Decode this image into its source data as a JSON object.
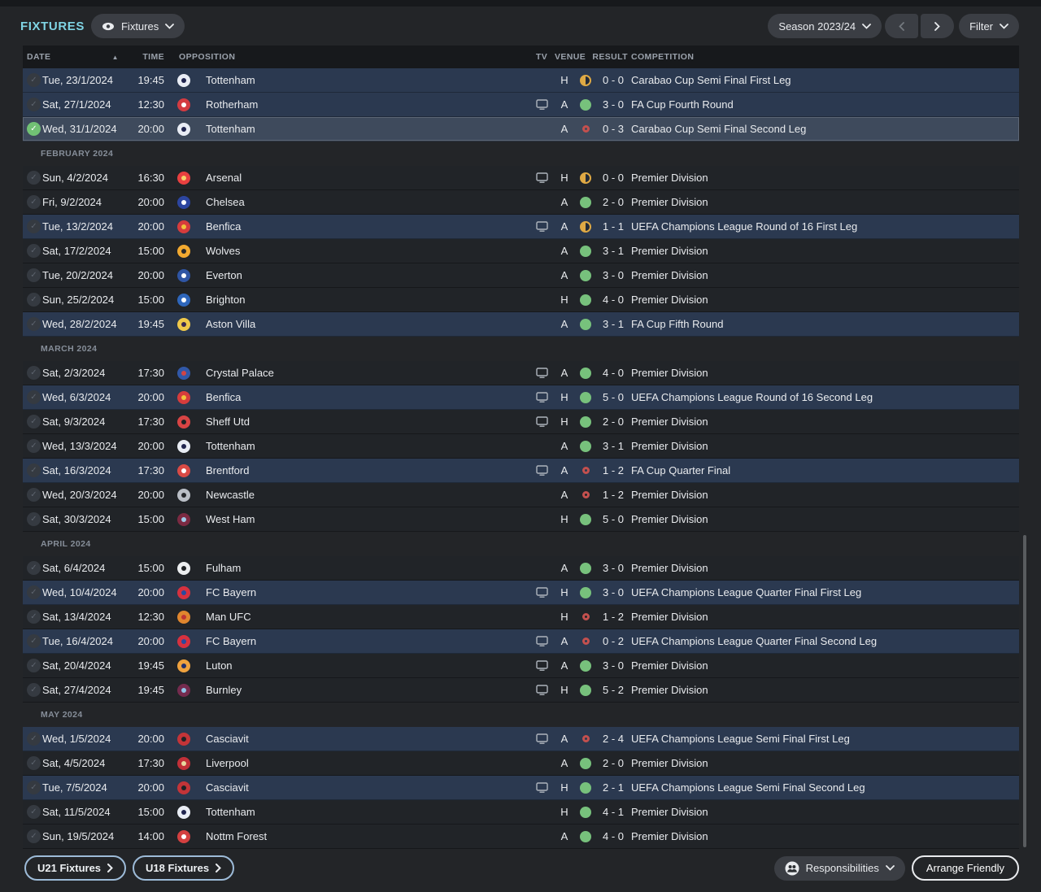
{
  "header": {
    "title": "FIXTURES",
    "view_dropdown_label": "Fixtures",
    "season_dropdown_label": "Season 2023/24",
    "filter_dropdown_label": "Filter"
  },
  "table": {
    "columns": {
      "date": "DATE",
      "time": "TIME",
      "opposition": "OPPOSITION",
      "tv": "TV",
      "venue": "VENUE",
      "result": "RESULT",
      "competition": "COMPETITION"
    },
    "sort": {
      "column": "DATE",
      "direction": "asc"
    },
    "sections": [
      {
        "month": "",
        "fixtures": [
          {
            "date": "Tue, 23/1/2024",
            "time": "19:45",
            "opposition": "Tottenham",
            "badge": [
              "#e9edf5",
              "#20254f"
            ],
            "tv": false,
            "venue": "H",
            "outcome": "draw",
            "score": "0 - 0",
            "competition": "Carabao Cup Semi Final First Leg",
            "cup": true,
            "selected": false
          },
          {
            "date": "Sat, 27/1/2024",
            "time": "12:30",
            "opposition": "Rotherham",
            "badge": [
              "#d43b41",
              "#ffffff"
            ],
            "tv": true,
            "venue": "A",
            "outcome": "win",
            "score": "3 - 0",
            "competition": "FA Cup Fourth Round",
            "cup": true,
            "selected": false
          },
          {
            "date": "Wed, 31/1/2024",
            "time": "20:00",
            "opposition": "Tottenham",
            "badge": [
              "#e9edf5",
              "#20254f"
            ],
            "tv": false,
            "venue": "A",
            "outcome": "loss",
            "score": "0 - 3",
            "competition": "Carabao Cup Semi Final Second Leg",
            "cup": true,
            "selected": true
          }
        ]
      },
      {
        "month": "FEBRUARY 2024",
        "fixtures": [
          {
            "date": "Sun, 4/2/2024",
            "time": "16:30",
            "opposition": "Arsenal",
            "badge": [
              "#e84040",
              "#f5d16a"
            ],
            "tv": true,
            "venue": "H",
            "outcome": "draw",
            "score": "0 - 0",
            "competition": "Premier Division",
            "cup": false,
            "selected": false
          },
          {
            "date": "Fri, 9/2/2024",
            "time": "20:00",
            "opposition": "Chelsea",
            "badge": [
              "#2c45a0",
              "#ffffff"
            ],
            "tv": false,
            "venue": "A",
            "outcome": "win",
            "score": "2 - 0",
            "competition": "Premier Division",
            "cup": false,
            "selected": false
          },
          {
            "date": "Tue, 13/2/2024",
            "time": "20:00",
            "opposition": "Benfica",
            "badge": [
              "#d63c3c",
              "#f0c23c"
            ],
            "tv": true,
            "venue": "A",
            "outcome": "draw",
            "score": "1 - 1",
            "competition": "UEFA Champions League Round of 16  First Leg",
            "cup": true,
            "selected": false
          },
          {
            "date": "Sat, 17/2/2024",
            "time": "15:00",
            "opposition": "Wolves",
            "badge": [
              "#f2a930",
              "#2a2a2a"
            ],
            "tv": false,
            "venue": "A",
            "outcome": "win",
            "score": "3 - 1",
            "competition": "Premier Division",
            "cup": false,
            "selected": false
          },
          {
            "date": "Tue, 20/2/2024",
            "time": "20:00",
            "opposition": "Everton",
            "badge": [
              "#2f55a4",
              "#ffffff"
            ],
            "tv": false,
            "venue": "A",
            "outcome": "win",
            "score": "3 - 0",
            "competition": "Premier Division",
            "cup": false,
            "selected": false
          },
          {
            "date": "Sun, 25/2/2024",
            "time": "15:00",
            "opposition": "Brighton",
            "badge": [
              "#2e66bb",
              "#ffffff"
            ],
            "tv": false,
            "venue": "H",
            "outcome": "win",
            "score": "4 - 0",
            "competition": "Premier Division",
            "cup": false,
            "selected": false
          },
          {
            "date": "Wed, 28/2/2024",
            "time": "19:45",
            "opposition": "Aston Villa",
            "badge": [
              "#f0c94a",
              "#3b2a52"
            ],
            "tv": false,
            "venue": "A",
            "outcome": "win",
            "score": "3 - 1",
            "competition": "FA Cup Fifth Round",
            "cup": true,
            "selected": false
          }
        ]
      },
      {
        "month": "MARCH 2024",
        "fixtures": [
          {
            "date": "Sat, 2/3/2024",
            "time": "17:30",
            "opposition": "Crystal Palace",
            "badge": [
              "#3158a8",
              "#d04545"
            ],
            "tv": true,
            "venue": "A",
            "outcome": "win",
            "score": "4 - 0",
            "competition": "Premier Division",
            "cup": false,
            "selected": false
          },
          {
            "date": "Wed, 6/3/2024",
            "time": "20:00",
            "opposition": "Benfica",
            "badge": [
              "#d63c3c",
              "#f0c23c"
            ],
            "tv": true,
            "venue": "H",
            "outcome": "win",
            "score": "5 - 0",
            "competition": "UEFA Champions League Round of 16  Second Leg",
            "cup": true,
            "selected": false
          },
          {
            "date": "Sat, 9/3/2024",
            "time": "17:30",
            "opposition": "Sheff Utd",
            "badge": [
              "#d84444",
              "#1f2225"
            ],
            "tv": true,
            "venue": "H",
            "outcome": "win",
            "score": "2 - 0",
            "competition": "Premier Division",
            "cup": false,
            "selected": false
          },
          {
            "date": "Wed, 13/3/2024",
            "time": "20:00",
            "opposition": "Tottenham",
            "badge": [
              "#e9edf5",
              "#20254f"
            ],
            "tv": false,
            "venue": "A",
            "outcome": "win",
            "score": "3 - 1",
            "competition": "Premier Division",
            "cup": false,
            "selected": false
          },
          {
            "date": "Sat, 16/3/2024",
            "time": "17:30",
            "opposition": "Brentford",
            "badge": [
              "#d94a45",
              "#ffffff"
            ],
            "tv": true,
            "venue": "A",
            "outcome": "loss",
            "score": "1 - 2",
            "competition": "FA Cup Quarter Final",
            "cup": true,
            "selected": false
          },
          {
            "date": "Wed, 20/3/2024",
            "time": "20:00",
            "opposition": "Newcastle",
            "badge": [
              "#b9bec6",
              "#23262a"
            ],
            "tv": false,
            "venue": "A",
            "outcome": "loss",
            "score": "1 - 2",
            "competition": "Premier Division",
            "cup": false,
            "selected": false
          },
          {
            "date": "Sat, 30/3/2024",
            "time": "15:00",
            "opposition": "West Ham",
            "badge": [
              "#7b2a42",
              "#9ecbe8"
            ],
            "tv": false,
            "venue": "H",
            "outcome": "win",
            "score": "5 - 0",
            "competition": "Premier Division",
            "cup": false,
            "selected": false
          }
        ]
      },
      {
        "month": "APRIL 2024",
        "fixtures": [
          {
            "date": "Sat, 6/4/2024",
            "time": "15:00",
            "opposition": "Fulham",
            "badge": [
              "#eceef0",
              "#1f2225"
            ],
            "tv": false,
            "venue": "A",
            "outcome": "win",
            "score": "3 - 0",
            "competition": "Premier Division",
            "cup": false,
            "selected": false
          },
          {
            "date": "Wed, 10/4/2024",
            "time": "20:00",
            "opposition": "FC Bayern",
            "badge": [
              "#d6313f",
              "#2a4a9e"
            ],
            "tv": true,
            "venue": "H",
            "outcome": "win",
            "score": "3 - 0",
            "competition": "UEFA Champions League Quarter Final First Leg",
            "cup": true,
            "selected": false
          },
          {
            "date": "Sat, 13/4/2024",
            "time": "12:30",
            "opposition": "Man UFC",
            "badge": [
              "#e0862e",
              "#c03535"
            ],
            "tv": false,
            "venue": "H",
            "outcome": "loss",
            "score": "1 - 2",
            "competition": "Premier Division",
            "cup": false,
            "selected": false
          },
          {
            "date": "Tue, 16/4/2024",
            "time": "20:00",
            "opposition": "FC Bayern",
            "badge": [
              "#d6313f",
              "#2a4a9e"
            ],
            "tv": true,
            "venue": "A",
            "outcome": "loss",
            "score": "0 - 2",
            "competition": "UEFA Champions League Quarter Final Second Leg",
            "cup": true,
            "selected": false
          },
          {
            "date": "Sat, 20/4/2024",
            "time": "19:45",
            "opposition": "Luton",
            "badge": [
              "#efa23e",
              "#22306e"
            ],
            "tv": true,
            "venue": "A",
            "outcome": "win",
            "score": "3 - 0",
            "competition": "Premier Division",
            "cup": false,
            "selected": false
          },
          {
            "date": "Sat, 27/4/2024",
            "time": "19:45",
            "opposition": "Burnley",
            "badge": [
              "#742b4e",
              "#8fc5e8"
            ],
            "tv": true,
            "venue": "H",
            "outcome": "win",
            "score": "5 - 2",
            "competition": "Premier Division",
            "cup": false,
            "selected": false
          }
        ]
      },
      {
        "month": "MAY 2024",
        "fixtures": [
          {
            "date": "Wed, 1/5/2024",
            "time": "20:00",
            "opposition": "Casciavit",
            "badge": [
              "#c33438",
              "#1f2225"
            ],
            "tv": true,
            "venue": "A",
            "outcome": "loss",
            "score": "2 - 4",
            "competition": "UEFA Champions League Semi Final First Leg",
            "cup": true,
            "selected": false
          },
          {
            "date": "Sat, 4/5/2024",
            "time": "17:30",
            "opposition": "Liverpool",
            "badge": [
              "#c23038",
              "#e8d9a0"
            ],
            "tv": false,
            "venue": "A",
            "outcome": "win",
            "score": "2 - 0",
            "competition": "Premier Division",
            "cup": false,
            "selected": false
          },
          {
            "date": "Tue, 7/5/2024",
            "time": "20:00",
            "opposition": "Casciavit",
            "badge": [
              "#c33438",
              "#1f2225"
            ],
            "tv": true,
            "venue": "H",
            "outcome": "win",
            "score": "2 - 1",
            "competition": "UEFA Champions League Semi Final Second Leg",
            "cup": true,
            "selected": false
          },
          {
            "date": "Sat, 11/5/2024",
            "time": "15:00",
            "opposition": "Tottenham",
            "badge": [
              "#e9edf5",
              "#20254f"
            ],
            "tv": false,
            "venue": "H",
            "outcome": "win",
            "score": "4 - 1",
            "competition": "Premier Division",
            "cup": false,
            "selected": false
          },
          {
            "date": "Sun, 19/5/2024",
            "time": "14:00",
            "opposition": "Nottm Forest",
            "badge": [
              "#d44040",
              "#ffffff"
            ],
            "tv": false,
            "venue": "A",
            "outcome": "win",
            "score": "4 - 0",
            "competition": "Premier Division",
            "cup": false,
            "selected": false
          }
        ]
      }
    ]
  },
  "footer": {
    "u21_label": "U21 Fixtures",
    "u18_label": "U18 Fixtures",
    "responsibilities_label": "Responsibilities",
    "arrange_friendly_label": "Arrange Friendly"
  },
  "colors": {
    "accent_teal": "#7fd4e4",
    "cup_row_bg": "#2b3950",
    "league_row_bg": "#212428",
    "selected_row_bg": "#3e4a5c",
    "win": "#77c17c",
    "draw": "#dfa944",
    "loss": "#c4504e"
  }
}
